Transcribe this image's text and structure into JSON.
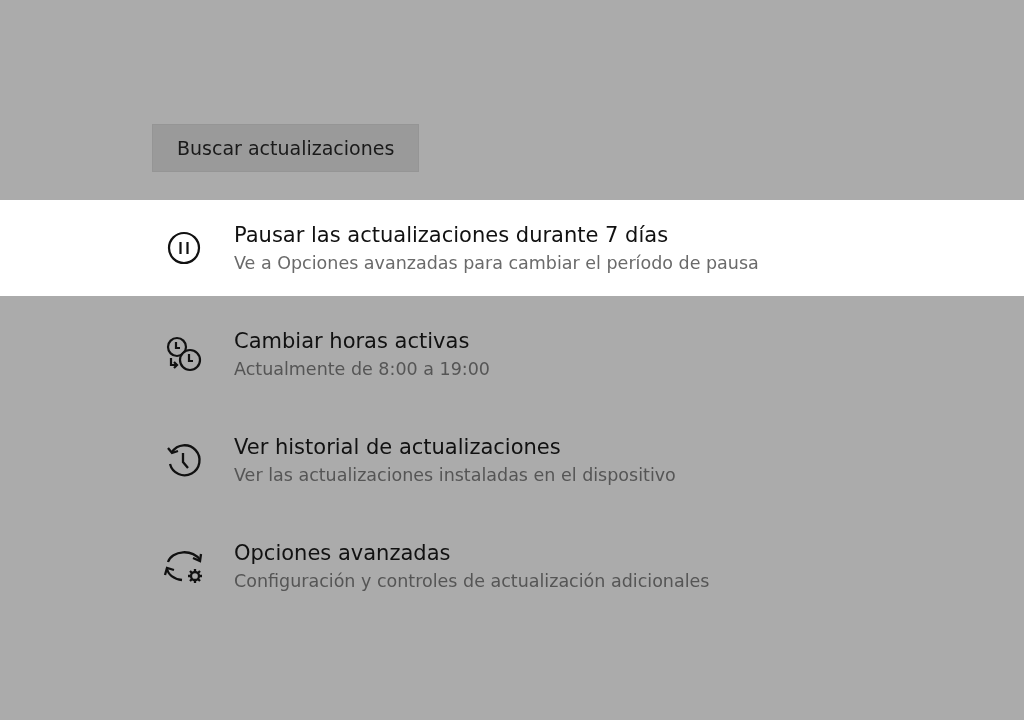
{
  "check_button": {
    "label": "Buscar actualizaciones"
  },
  "options": [
    {
      "kind": "pause",
      "title": "Pausar las actualizaciones durante 7 días",
      "subtitle": "Ve a Opciones avanzadas para cambiar el período de pausa",
      "selected": true
    },
    {
      "kind": "active-hours",
      "title": "Cambiar horas activas",
      "subtitle": "Actualmente de 8:00 a 19:00",
      "selected": false
    },
    {
      "kind": "history",
      "title": "Ver historial de actualizaciones",
      "subtitle": "Ver las actualizaciones instaladas en el dispositivo",
      "selected": false
    },
    {
      "kind": "advanced",
      "title": "Opciones avanzadas",
      "subtitle": "Configuración y controles de actualización adicionales",
      "selected": false
    }
  ]
}
